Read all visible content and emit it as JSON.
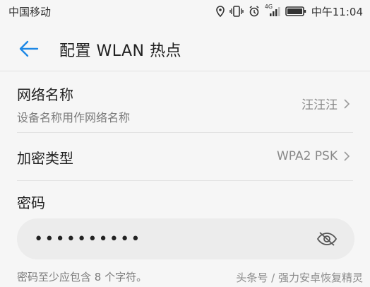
{
  "status_bar": {
    "carrier": "中国移动",
    "network": "4G",
    "time": "中午11:04"
  },
  "header": {
    "title": "配置 WLAN 热点"
  },
  "network_name": {
    "label": "网络名称",
    "subtitle": "设备名称用作网络名称",
    "value": "汪汪汪"
  },
  "encryption": {
    "label": "加密类型",
    "value": "WPA2 PSK"
  },
  "password": {
    "label": "密码",
    "value": "••••••••••",
    "hint": "密码至少应包含 8 个字符。"
  },
  "watermark": "头条号 / 强力安卓恢复精灵",
  "icons": {
    "back": "back-arrow-icon",
    "eye": "eye-off-icon",
    "chevron": "chevron-right-icon"
  },
  "colors": {
    "accent": "#1e88e5",
    "background": "#f6f6f6",
    "field": "#ececec"
  }
}
